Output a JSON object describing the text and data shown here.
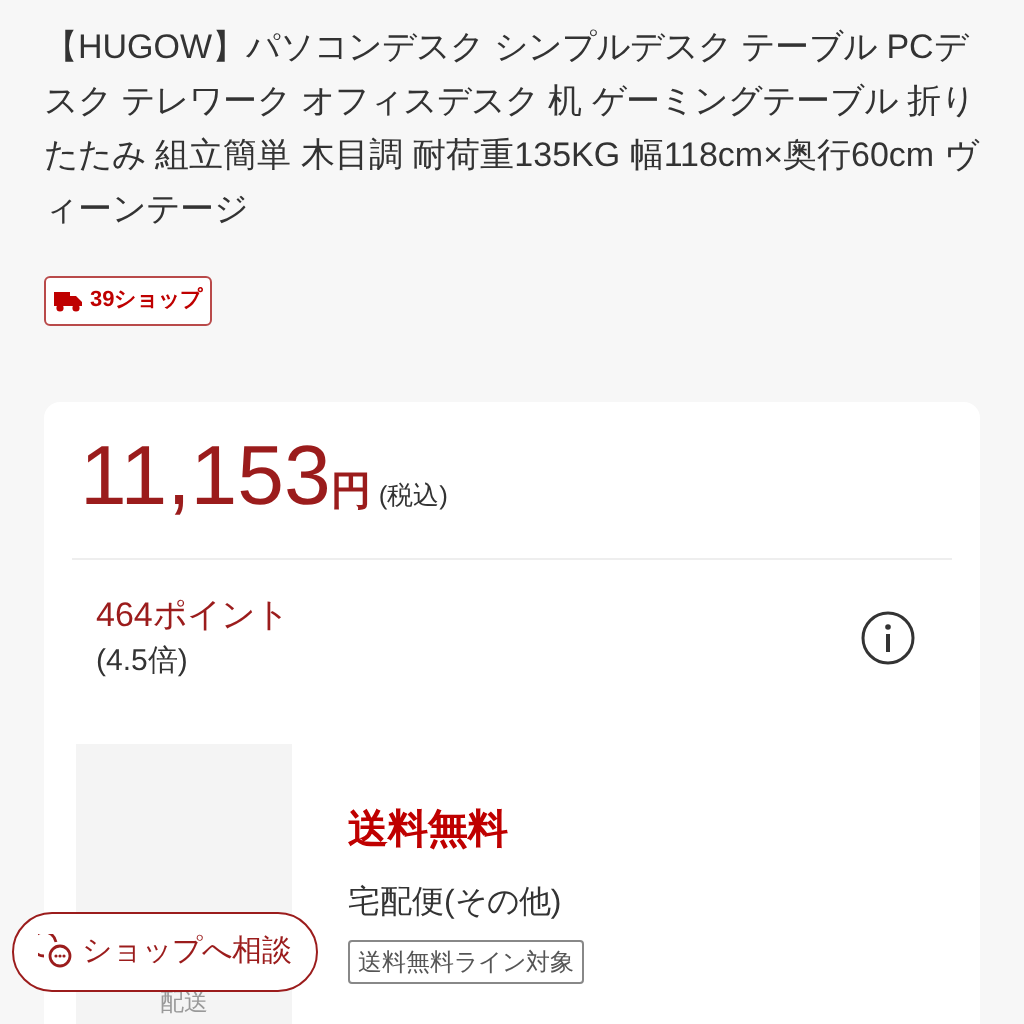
{
  "product_title": "【HUGOW】パソコンデスク シンプルデスク テーブル PCデスク テレワーク オフィスデスク 机 ゲーミングテーブル 折りたたみ 組立簡単 木目調 耐荷重135KG 幅118cm×奥行60cm ヴィーンテージ",
  "shop_badge": "39ショップ",
  "price": {
    "amount": "11,153",
    "unit": "円",
    "tax_note": "(税込)"
  },
  "points": {
    "amount": "464ポイント",
    "rate": "(4.5倍)"
  },
  "shipping": {
    "thumbnail_label": "配送",
    "headline": "送料無料",
    "method": "宅配便(その他)",
    "tag": "送料無料ライン対象"
  },
  "consult_button": "ショップへ相談"
}
